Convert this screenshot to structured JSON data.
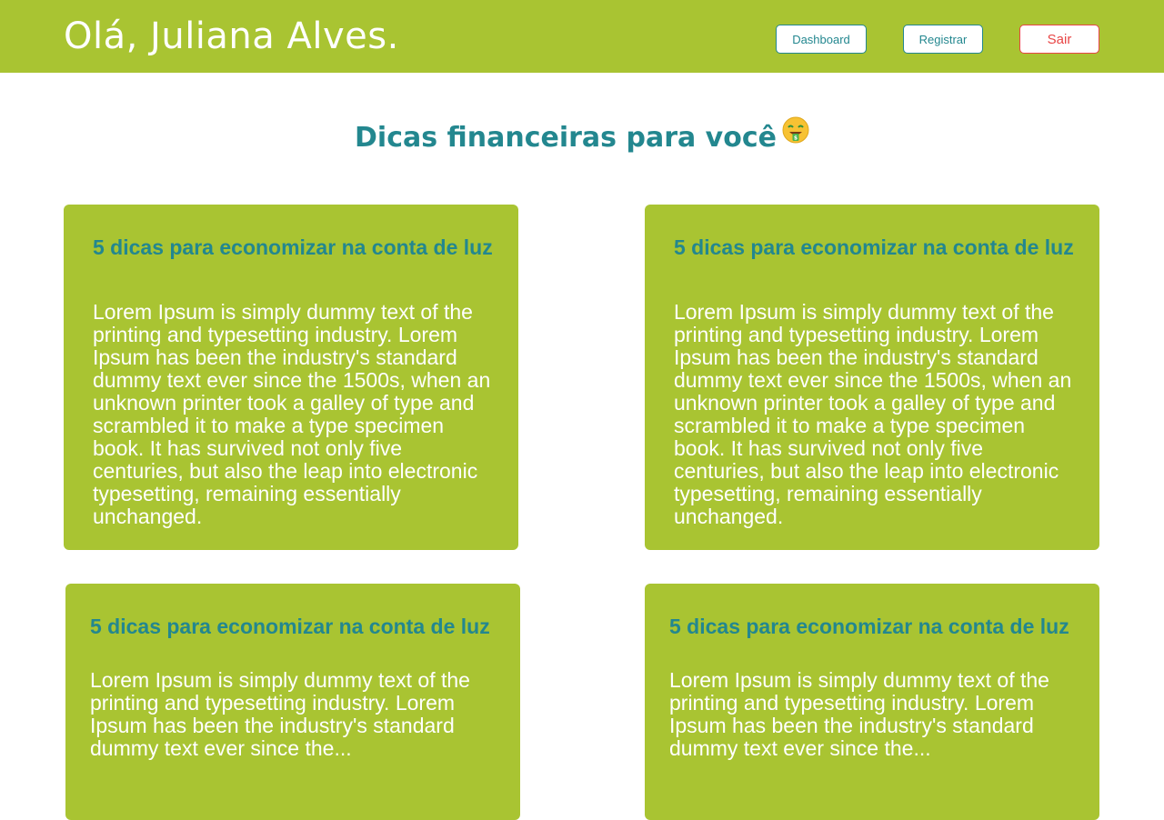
{
  "header": {
    "greeting": "Olá, Juliana Alves.",
    "nav": {
      "dashboard": "Dashboard",
      "registrar": "Registrar",
      "sair": "Sair"
    }
  },
  "main": {
    "title": "Dicas financeiras para você",
    "title_emoji": "money-mouth-face-icon",
    "cards": [
      {
        "title": "5 dicas para economizar na conta de luz",
        "body": "Lorem Ipsum is simply dummy text of the printing and typesetting industry. Lorem Ipsum has been the industry's standard dummy text ever since the 1500s, when an unknown printer took a galley of type and scrambled it to make a type specimen book. It has survived not only five centuries, but also the leap into electronic typesetting, remaining essentially unchanged."
      },
      {
        "title": "5 dicas para economizar na conta de luz",
        "body": "Lorem Ipsum is simply dummy text of the printing and typesetting industry. Lorem Ipsum has been the industry's standard dummy text ever since the 1500s, when an unknown printer took a galley of type and scrambled it to make a type specimen book. It has survived not only five centuries, but also the leap into electronic typesetting, remaining essentially unchanged."
      },
      {
        "title": "5 dicas para economizar na conta de luz",
        "body": "Lorem Ipsum is simply dummy text of the printing and typesetting industry. Lorem Ipsum has been the industry's standard dummy text ever since the..."
      },
      {
        "title": "5 dicas para economizar na conta de luz",
        "body": "Lorem Ipsum is simply dummy text of the printing and typesetting industry. Lorem Ipsum has been the industry's standard dummy text ever since the..."
      }
    ]
  },
  "colors": {
    "brand_green": "#a9c432",
    "accent_teal": "#23878f",
    "danger_red": "#e84545",
    "text_white": "#ffffff"
  }
}
